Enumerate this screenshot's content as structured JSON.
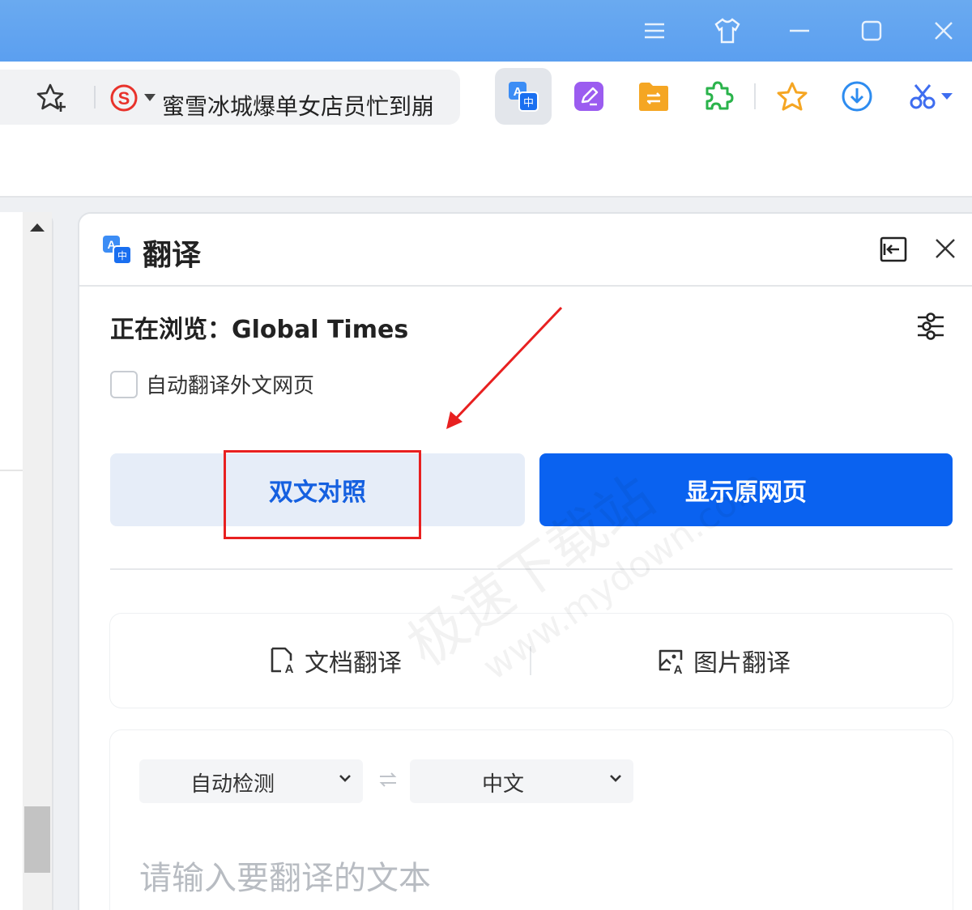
{
  "titlebar": {
    "icons": [
      "menu-icon",
      "skin-icon",
      "minimize-icon",
      "maximize-icon",
      "close-icon"
    ]
  },
  "toolbar": {
    "address_text": "蜜雪冰城爆单女店员忙到崩",
    "tools": [
      "translate-icon",
      "note-icon",
      "file-transfer-icon",
      "extension-icon",
      "favorite-icon",
      "download-icon",
      "screenshot-icon"
    ]
  },
  "panel": {
    "title": "翻译",
    "browsing_label": "正在浏览：Global Times",
    "auto_translate_label": "自动翻译外文网页",
    "bilingual_button": "双文对照",
    "original_button": "显示原网页",
    "doc_translate": "文档翻译",
    "image_translate": "图片翻译",
    "source_lang": "自动检测",
    "target_lang": "中文",
    "input_placeholder": "请输入要翻译的文本"
  },
  "watermark": {
    "text": "极速下载站",
    "url": "www.mydown.com"
  },
  "colors": {
    "accent": "#0a62f0",
    "annotation": "#e82020"
  }
}
